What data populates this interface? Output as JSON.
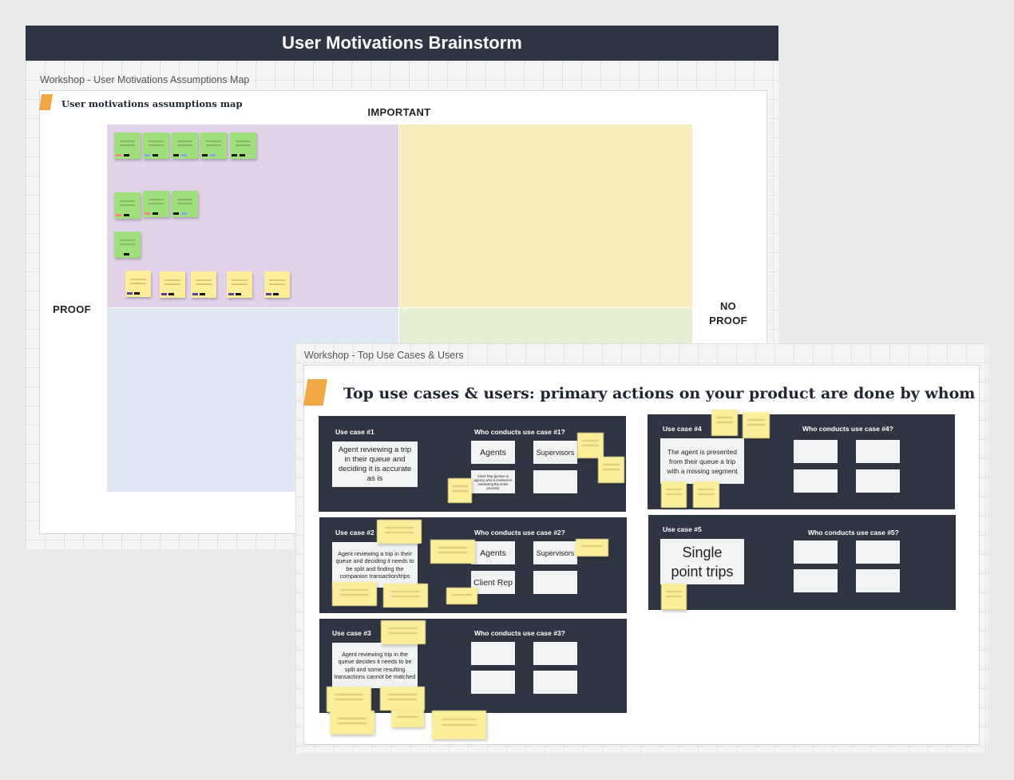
{
  "board1": {
    "banner_title": "User Motivations Brainstorm",
    "frame_label": "Workshop - User Motivations Assumptions Map",
    "card_title": "User motivations assumptions map",
    "axis_top": "IMPORTANT",
    "axis_left": "PROOF",
    "axis_right_1": "NO",
    "axis_right_2": "PROOF"
  },
  "board2": {
    "frame_label": "Workshop - Top Use Cases & Users",
    "title": "Top use cases & users: primary actions on your product are done by whom",
    "use_cases": [
      {
        "label": "Use case #1",
        "who": "Who conducts use case #1?",
        "description": "Agent reviewing a trip in their queue and deciding it is accurate as is",
        "users": [
          "Agents",
          "Supervisors",
          "Client Rep (person in agency who is involved in monitoring the entire process)",
          ""
        ]
      },
      {
        "label": "Use case #2",
        "who": "Who conducts use case #2?",
        "description": "Agent reviewing a trip in their queue and deciding it needs to be split and finding the companion transaction/trips",
        "users": [
          "Agents",
          "Supervisors",
          "Client Rep",
          ""
        ]
      },
      {
        "label": "Use case #3",
        "who": "Who conducts use case #3?",
        "description": "Agent reviewing trip in the queue decides it needs to be split and some resulting transactions cannot be matched",
        "users": [
          "",
          "",
          "",
          ""
        ]
      },
      {
        "label": "Use case #4",
        "who": "Who conducts use case #4?",
        "description": "The agent is presented from their queue a trip with a missing segment",
        "users": [
          "",
          "",
          "",
          ""
        ]
      },
      {
        "label": "Use case #5",
        "who": "Who conducts use case #5?",
        "description_1": "Single",
        "description_2": "point trips",
        "users": [
          "",
          "",
          "",
          ""
        ]
      }
    ]
  },
  "colors": {
    "banner": "#2f3542",
    "panel": "#2f3542",
    "tag": "#f2a745",
    "quadrant_purple": "#e2d3ea",
    "quadrant_yellow": "#f7ecbe",
    "quadrant_blue": "#dde8f2",
    "quadrant_green": "#e5efd3",
    "sticky_green": "#9fe07d",
    "sticky_yellow": "#fdee97"
  }
}
